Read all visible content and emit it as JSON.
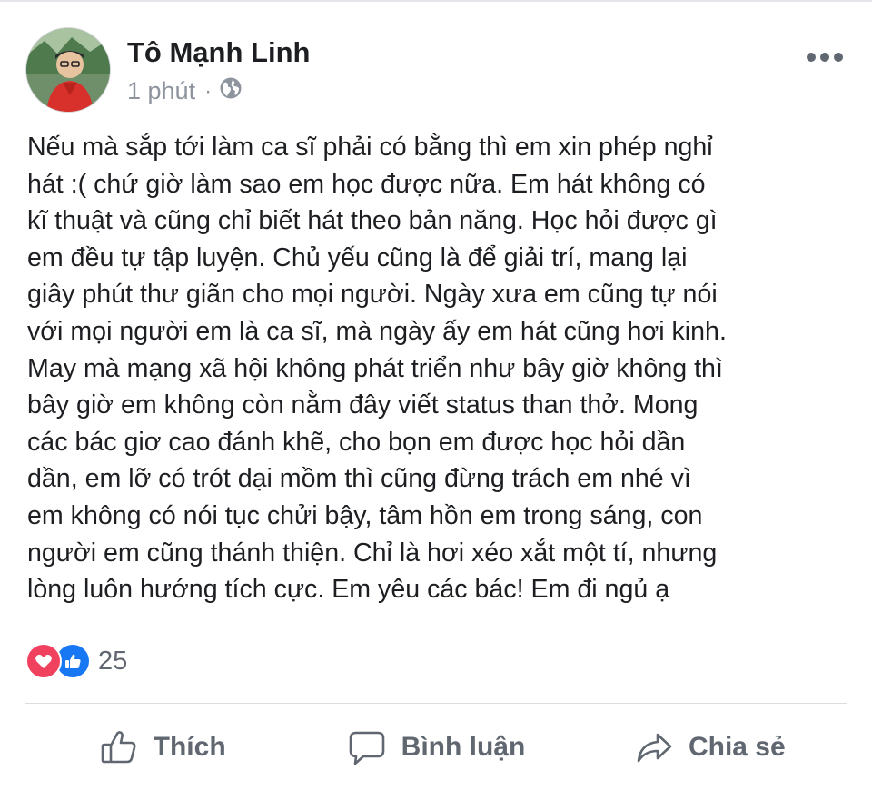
{
  "post": {
    "author": "Tô Mạnh Linh",
    "time": "1 phút",
    "separator": "·",
    "text": "Nếu mà sắp tới làm ca sĩ phải có bằng thì em xin phép nghỉ\nhát :( chứ giờ làm sao em học được nữa.  Em hát không có\nkĩ thuật và cũng chỉ biết hát theo bản năng. Học hỏi được gì\nem đều tự tập luyện. Chủ yếu cũng là để giải trí, mang lại\ngiây phút thư giãn cho mọi người. Ngày xưa em cũng tự nói\nvới mọi người em là ca sĩ, mà ngày ấy em hát cũng hơi kinh.\nMay mà mạng xã hội không phát triển như bây giờ không thì\nbây giờ em không còn nằm đây viết status than thở. Mong\ncác bác giơ cao đánh khẽ, cho bọn em được học hỏi dần\ndần, em lỡ có trót dại mồm thì cũng đừng trách em nhé vì\nem không có nói tục chửi bậy, tâm hồn em trong sáng, con\nngười em cũng thánh thiện. Chỉ là hơi xéo xắt một tí, nhưng\nlòng luôn hướng tích cực. Em yêu các bác! Em đi ngủ ạ"
  },
  "reactions": {
    "count": "25",
    "types": [
      "love-icon",
      "like-icon"
    ]
  },
  "actions": {
    "like_label": "Thích",
    "comment_label": "Bình luận",
    "share_label": "Chia sẻ"
  },
  "icons": {
    "privacy": "globe-icon",
    "more": "more-options-icon",
    "like": "thumbs-up-icon",
    "comment": "comment-bubble-icon",
    "share": "share-arrow-icon"
  },
  "colors": {
    "text": "#1c1e21",
    "muted": "#606770",
    "meta": "#8d949e",
    "love": "#f0415f",
    "like": "#1877f2",
    "divider": "#dadde1"
  }
}
